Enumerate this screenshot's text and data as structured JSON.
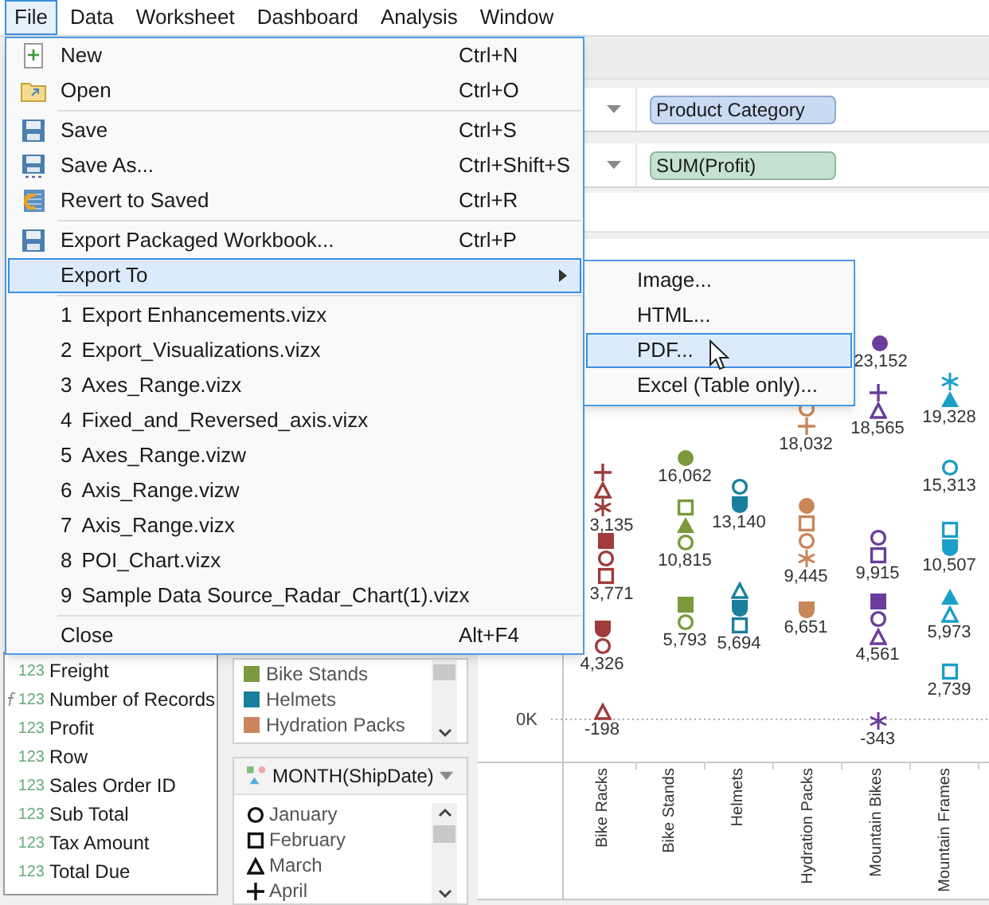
{
  "menu_bar": [
    {
      "label": "File",
      "selected": true
    },
    {
      "label": "Data",
      "selected": false
    },
    {
      "label": "Worksheet",
      "selected": false
    },
    {
      "label": "Dashboard",
      "selected": false
    },
    {
      "label": "Analysis",
      "selected": false
    },
    {
      "label": "Window",
      "selected": false
    }
  ],
  "file_menu": [
    {
      "kind": "command",
      "label": "New",
      "shortcut": "Ctrl+N",
      "selected": false
    },
    {
      "kind": "command",
      "label": "Open",
      "shortcut": "Ctrl+O",
      "selected": false
    },
    {
      "kind": "separator"
    },
    {
      "kind": "command",
      "label": "Save",
      "shortcut": "Ctrl+S",
      "selected": false
    },
    {
      "kind": "command",
      "label": "Save As...",
      "shortcut": "Ctrl+Shift+S",
      "selected": false
    },
    {
      "kind": "command",
      "label": "Revert to Saved",
      "shortcut": "Ctrl+R",
      "selected": false
    },
    {
      "kind": "separator"
    },
    {
      "kind": "command",
      "label": "Export Packaged Workbook...",
      "shortcut": "Ctrl+P",
      "selected": false
    },
    {
      "kind": "submenu",
      "label": "Export To",
      "selected": true
    },
    {
      "kind": "separator"
    },
    {
      "kind": "recent",
      "number": "1",
      "label": "Export Enhancements.vizx",
      "selected": false
    },
    {
      "kind": "recent",
      "number": "2",
      "label": "Export_Visualizations.vizx",
      "selected": false
    },
    {
      "kind": "recent",
      "number": "3",
      "label": "Axes_Range.vizx",
      "selected": false
    },
    {
      "kind": "recent",
      "number": "4",
      "label": "Fixed_and_Reversed_axis.vizx",
      "selected": false
    },
    {
      "kind": "recent",
      "number": "5",
      "label": "Axes_Range.vizw",
      "selected": false
    },
    {
      "kind": "recent",
      "number": "6",
      "label": "Axis_Range.vizw",
      "selected": false
    },
    {
      "kind": "recent",
      "number": "7",
      "label": "Axis_Range.vizx",
      "selected": false
    },
    {
      "kind": "recent",
      "number": "8",
      "label": "POI_Chart.vizx",
      "selected": false
    },
    {
      "kind": "recent",
      "number": "9",
      "label": "Sample Data Source_Radar_Chart(1).vizx",
      "selected": false
    },
    {
      "kind": "separator"
    },
    {
      "kind": "command",
      "label": "Close",
      "shortcut": "Alt+F4",
      "selected": false
    }
  ],
  "export_submenu": [
    {
      "label": "Image...",
      "selected": false
    },
    {
      "label": "HTML...",
      "selected": false
    },
    {
      "label": "PDF...",
      "selected": true
    },
    {
      "label": "Excel (Table only)...",
      "selected": false
    }
  ],
  "shelves": [
    {
      "kind": "dimension",
      "pill": "Product Category"
    },
    {
      "kind": "measure",
      "pill": "SUM(Profit)"
    }
  ],
  "chart": {
    "zero_tick": "0K",
    "categories": [
      "Bike Racks",
      "Bike Stands",
      "Helmets",
      "Hydration Packs",
      "Mountain Bikes",
      "Mountain Frames"
    ],
    "points": [
      {
        "color": "#9e3b3b",
        "shapes": [
          {
            "kind": "plus"
          },
          {
            "kind": "triangle"
          },
          {
            "kind": "asterisk"
          }
        ],
        "label": "3,135"
      },
      {
        "color": "#9e3b3b",
        "shapes": [
          {
            "kind": "square-filled"
          },
          {
            "kind": "circle"
          },
          {
            "kind": "square"
          }
        ],
        "label": "3,771"
      },
      {
        "color": "#9e3b3b",
        "shapes": [
          {
            "kind": "shield"
          },
          {
            "kind": "circle"
          }
        ],
        "label": "4,326"
      },
      {
        "color": "#9e3b3b",
        "shapes": [
          {
            "kind": "triangle"
          }
        ],
        "label": "-198"
      },
      {
        "color": "#7a9a3c",
        "shapes": [
          {
            "kind": "circle-filled"
          }
        ],
        "label": "16,062"
      },
      {
        "color": "#7a9a3c",
        "shapes": [
          {
            "kind": "square"
          },
          {
            "kind": "triangle-filled"
          },
          {
            "kind": "circle"
          }
        ],
        "label": "10,815"
      },
      {
        "color": "#7a9a3c",
        "shapes": [
          {
            "kind": "square-filled"
          },
          {
            "kind": "circle"
          }
        ],
        "label": "5,793"
      },
      {
        "color": "#1a7f9c",
        "shapes": [
          {
            "kind": "circle"
          },
          {
            "kind": "shield"
          }
        ],
        "label": "13,140"
      },
      {
        "color": "#1a7f9c",
        "shapes": [
          {
            "kind": "triangle"
          },
          {
            "kind": "shield"
          },
          {
            "kind": "square"
          }
        ],
        "label": "5,694"
      },
      {
        "color": "#c8865a",
        "shapes": [
          {
            "kind": "circle"
          },
          {
            "kind": "plus"
          }
        ],
        "label": "18,032"
      },
      {
        "color": "#c8865a",
        "shapes": [
          {
            "kind": "circle-filled"
          },
          {
            "kind": "square"
          },
          {
            "kind": "circle"
          },
          {
            "kind": "asterisk"
          }
        ],
        "label": "9,445"
      },
      {
        "color": "#c8865a",
        "shapes": [
          {
            "kind": "shield"
          }
        ],
        "label": "6,651"
      },
      {
        "color": "#6a3d9a",
        "shapes": [
          {
            "kind": "circle-filled"
          }
        ],
        "label": "23,152"
      },
      {
        "color": "#6a3d9a",
        "shapes": [
          {
            "kind": "plus"
          },
          {
            "kind": "triangle"
          }
        ],
        "label": "18,565"
      },
      {
        "color": "#6a3d9a",
        "shapes": [
          {
            "kind": "circle"
          },
          {
            "kind": "square"
          }
        ],
        "label": "9,915"
      },
      {
        "color": "#6a3d9a",
        "shapes": [
          {
            "kind": "square-filled"
          },
          {
            "kind": "circle"
          },
          {
            "kind": "triangle"
          }
        ],
        "label": "4,561"
      },
      {
        "color": "#6a3d9a",
        "shapes": [
          {
            "kind": "asterisk"
          }
        ],
        "label": "-343"
      },
      {
        "color": "#1a9fc8",
        "shapes": [
          {
            "kind": "asterisk"
          },
          {
            "kind": "triangle-filled"
          }
        ],
        "label": "19,328"
      },
      {
        "color": "#1a9fc8",
        "shapes": [
          {
            "kind": "circle"
          }
        ],
        "label": "15,313"
      },
      {
        "color": "#1a9fc8",
        "shapes": [
          {
            "kind": "square"
          },
          {
            "kind": "shield"
          }
        ],
        "label": "10,507"
      },
      {
        "color": "#1a9fc8",
        "shapes": [
          {
            "kind": "triangle-filled"
          },
          {
            "kind": "triangle"
          }
        ],
        "label": "5,973"
      },
      {
        "color": "#1a9fc8",
        "shapes": [
          {
            "kind": "square"
          }
        ],
        "label": "2,739"
      }
    ]
  },
  "data_pane": [
    {
      "type": "123",
      "label": "Freight",
      "calculated": false
    },
    {
      "type": "123",
      "label": "Number of Records",
      "calculated": true
    },
    {
      "type": "123",
      "label": "Profit",
      "calculated": false
    },
    {
      "type": "123",
      "label": "Row",
      "calculated": false
    },
    {
      "type": "123",
      "label": "Sales Order ID",
      "calculated": false
    },
    {
      "type": "123",
      "label": "Sub Total",
      "calculated": false
    },
    {
      "type": "123",
      "label": "Tax Amount",
      "calculated": false
    },
    {
      "type": "123",
      "label": "Total Due",
      "calculated": false
    }
  ],
  "color_legend": [
    {
      "label": "Bike Stands",
      "color": "#7a9a3c"
    },
    {
      "label": "Helmets",
      "color": "#1a7f9c"
    },
    {
      "label": "Hydration Packs",
      "color": "#c8865a"
    }
  ],
  "shape_legend": {
    "title": "MONTH(ShipDate)",
    "items": [
      {
        "label": "January",
        "kind": "circle"
      },
      {
        "label": "February",
        "kind": "square"
      },
      {
        "label": "March",
        "kind": "triangle"
      },
      {
        "label": "April",
        "kind": "plus"
      }
    ]
  }
}
